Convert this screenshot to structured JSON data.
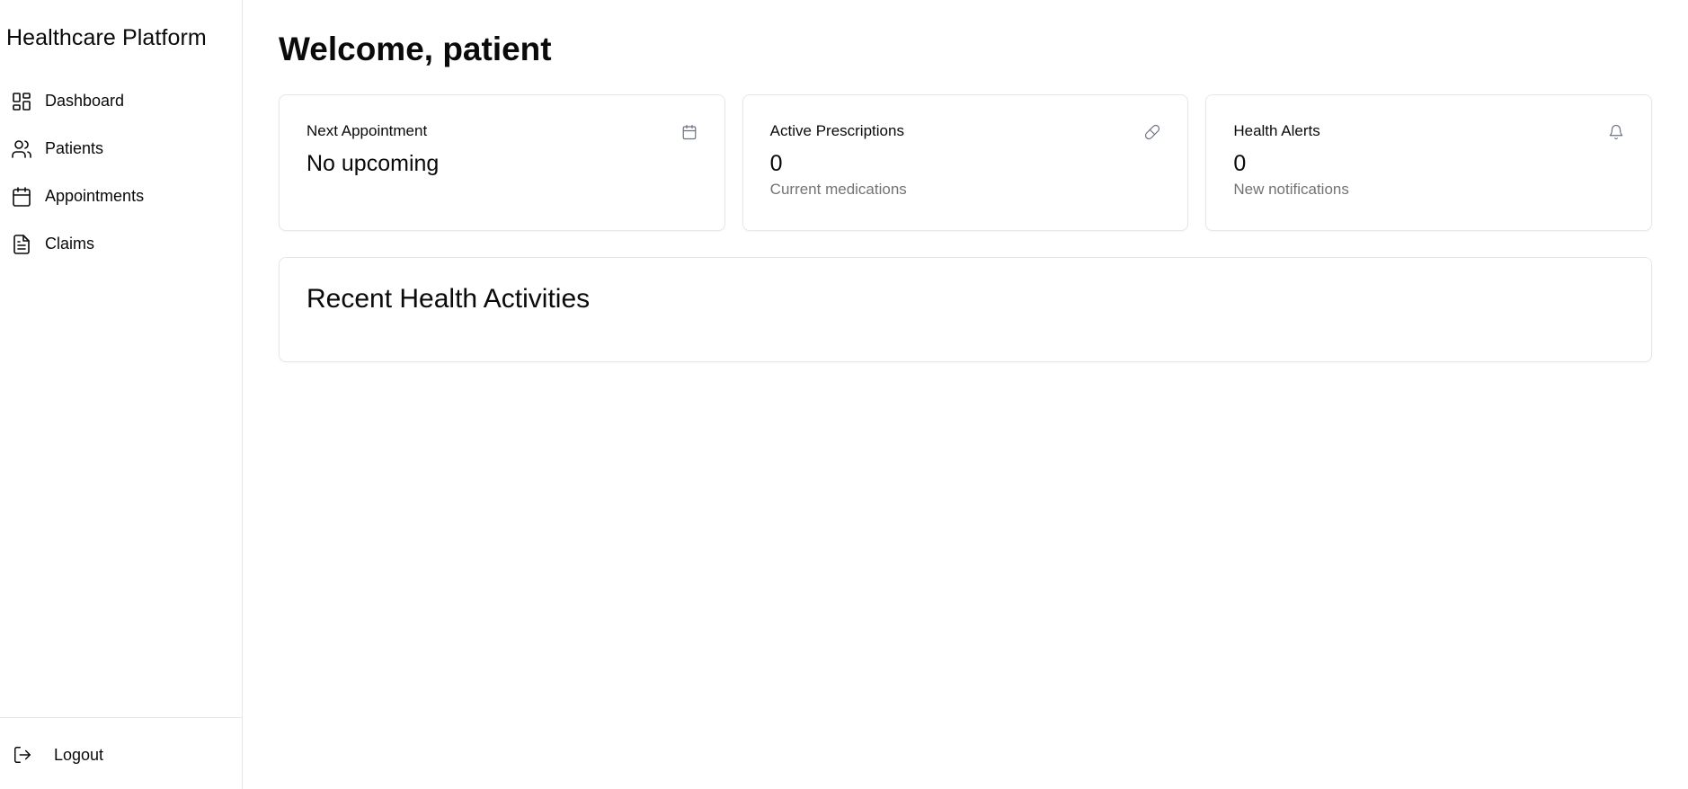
{
  "app": {
    "title": "Healthcare Platform"
  },
  "sidebar": {
    "items": [
      {
        "label": "Dashboard",
        "icon": "layout-dashboard-icon"
      },
      {
        "label": "Patients",
        "icon": "users-icon"
      },
      {
        "label": "Appointments",
        "icon": "calendar-icon"
      },
      {
        "label": "Claims",
        "icon": "file-text-icon"
      }
    ],
    "logout": {
      "label": "Logout",
      "icon": "logout-icon"
    }
  },
  "main": {
    "title": "Welcome, patient",
    "cards": [
      {
        "title": "Next Appointment",
        "value": "No upcoming",
        "subtitle": "",
        "icon": "calendar-icon"
      },
      {
        "title": "Active Prescriptions",
        "value": "0",
        "subtitle": "Current medications",
        "icon": "pill-icon"
      },
      {
        "title": "Health Alerts",
        "value": "0",
        "subtitle": "New notifications",
        "icon": "bell-icon"
      }
    ],
    "activities": {
      "title": "Recent Health Activities"
    }
  },
  "colors": {
    "text": "#0a0a0a",
    "muted": "#737373",
    "border": "#e5e7eb"
  }
}
